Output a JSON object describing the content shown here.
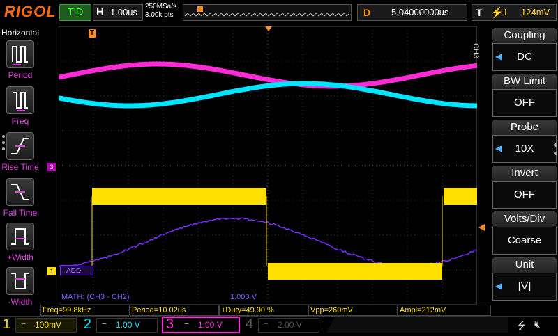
{
  "header": {
    "logo": "RIGOL",
    "status": "T'D",
    "horizontal_key": "H",
    "timebase": "1.00us",
    "sample_rate": "250MSa/s",
    "memory_depth": "3.00k pts",
    "delay_key": "D",
    "delay_value": "5.04000000us",
    "trigger_key": "T",
    "trigger_coupling_icon": "rising-edge-icon",
    "trigger_level": "124mV"
  },
  "left_panel": {
    "title": "Horizontal",
    "items": [
      {
        "label": "Period",
        "icon": "period-icon"
      },
      {
        "label": "Freq",
        "icon": "freq-icon"
      },
      {
        "label": "Rise Time",
        "icon": "rise-time-icon"
      },
      {
        "label": "Fall Time",
        "icon": "fall-time-icon"
      },
      {
        "label": "+Width",
        "icon": "pos-width-icon"
      },
      {
        "label": "-Width",
        "icon": "neg-width-icon"
      }
    ]
  },
  "right_menu": {
    "channel": "CH3",
    "items": [
      {
        "title": "Coupling",
        "value": "DC",
        "arrow": true
      },
      {
        "title": "BW Limit",
        "value": "OFF",
        "arrow": false
      },
      {
        "title": "Probe",
        "value": "10X",
        "arrow": true
      },
      {
        "title": "Invert",
        "value": "OFF",
        "arrow": false
      },
      {
        "title": "Volts/Div",
        "value": "Coarse",
        "arrow": false
      },
      {
        "title": "Unit",
        "value": "[V]",
        "arrow": true
      }
    ]
  },
  "screen": {
    "trigger_marker": "T",
    "ch3_marker": "3",
    "ch1_marker": "1",
    "math_label": "ADD",
    "math_info": "MATH: (CH3 - CH2)",
    "math_scale": "1.000 V"
  },
  "measurements": [
    "Freq=99.8kHz",
    "Period=10.02us",
    "+Duty=49.90 %",
    "Vpp=260mV",
    "Ampl=212mV"
  ],
  "channels": [
    {
      "num": "1",
      "coupling": "=",
      "scale": "100mV",
      "color": "#ffe000",
      "active": true
    },
    {
      "num": "2",
      "coupling": "=",
      "scale": "1.00 V",
      "color": "#00e5ff",
      "active": true
    },
    {
      "num": "3",
      "coupling": "=",
      "scale": "1.00 V",
      "color": "#ff2bd6",
      "active": true
    },
    {
      "num": "4",
      "coupling": "=",
      "scale": "2.00 V",
      "color": "#555555",
      "active": false
    }
  ],
  "colors": {
    "ch1": "#ffe000",
    "ch2": "#00e5ff",
    "ch3": "#ff2bd6",
    "math": "#7b2cff",
    "accent": "#ff8c1a"
  }
}
